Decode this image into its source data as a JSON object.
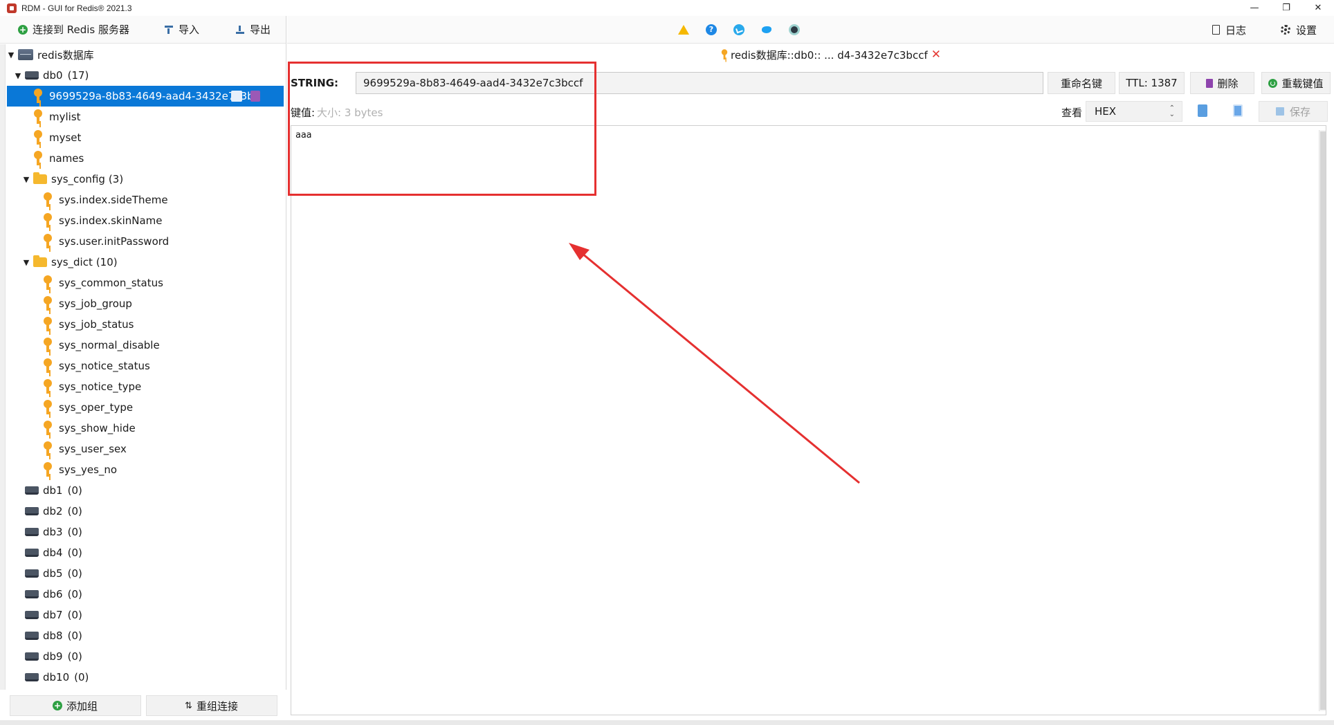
{
  "window": {
    "title": "RDM - GUI for Redis® 2021.3",
    "min_symbol": "—",
    "max_symbol": "❐",
    "close_symbol": "✕"
  },
  "left_toolbar": {
    "connect_label": "连接到 Redis 服务器",
    "import_label": "导入",
    "export_label": "导出"
  },
  "tree": {
    "server_name": "redis数据库",
    "db0": {
      "name": "db0",
      "count": "(17)"
    },
    "selected_key": "9699529a-8b83-4649-aad4-3432e7c3b",
    "keys": [
      "mylist",
      "myset",
      "names"
    ],
    "sys_config": {
      "name": "sys_config",
      "count": "(3)",
      "keys": [
        "sys.index.sideTheme",
        "sys.index.skinName",
        "sys.user.initPassword"
      ]
    },
    "sys_dict": {
      "name": "sys_dict",
      "count": "(10)",
      "keys": [
        "sys_common_status",
        "sys_job_group",
        "sys_job_status",
        "sys_normal_disable",
        "sys_notice_status",
        "sys_notice_type",
        "sys_oper_type",
        "sys_show_hide",
        "sys_user_sex",
        "sys_yes_no"
      ]
    },
    "databases": [
      {
        "name": "db1",
        "count": "(0)"
      },
      {
        "name": "db2",
        "count": "(0)"
      },
      {
        "name": "db3",
        "count": "(0)"
      },
      {
        "name": "db4",
        "count": "(0)"
      },
      {
        "name": "db5",
        "count": "(0)"
      },
      {
        "name": "db6",
        "count": "(0)"
      },
      {
        "name": "db7",
        "count": "(0)"
      },
      {
        "name": "db8",
        "count": "(0)"
      },
      {
        "name": "db9",
        "count": "(0)"
      },
      {
        "name": "db10",
        "count": "(0)"
      }
    ]
  },
  "left_bottom": {
    "add_group_label": "添加组",
    "regroup_label": "重组连接"
  },
  "top_right": {
    "log_label": "日志",
    "settings_label": "设置"
  },
  "tab": {
    "title": "redis数据库::db0:: ... d4-3432e7c3bccf"
  },
  "editor": {
    "type_label": "STRING:",
    "key_name": "9699529a-8b83-4649-aad4-3432e7c3bccf",
    "rename_label": "重命名键",
    "ttl_label": "TTL: 1387",
    "delete_label": "删除",
    "reload_label": "重载键值",
    "value_label": "键值:",
    "size_label": "大小: 3 bytes",
    "view_label": "查看",
    "view_format": "HEX",
    "save_label": "保存",
    "value_text": "aaa"
  },
  "colors": {
    "selection": "#0a78d7",
    "annotation": "#e53030",
    "key_icon": "#f5a623",
    "folder_icon": "#f5b82e"
  }
}
